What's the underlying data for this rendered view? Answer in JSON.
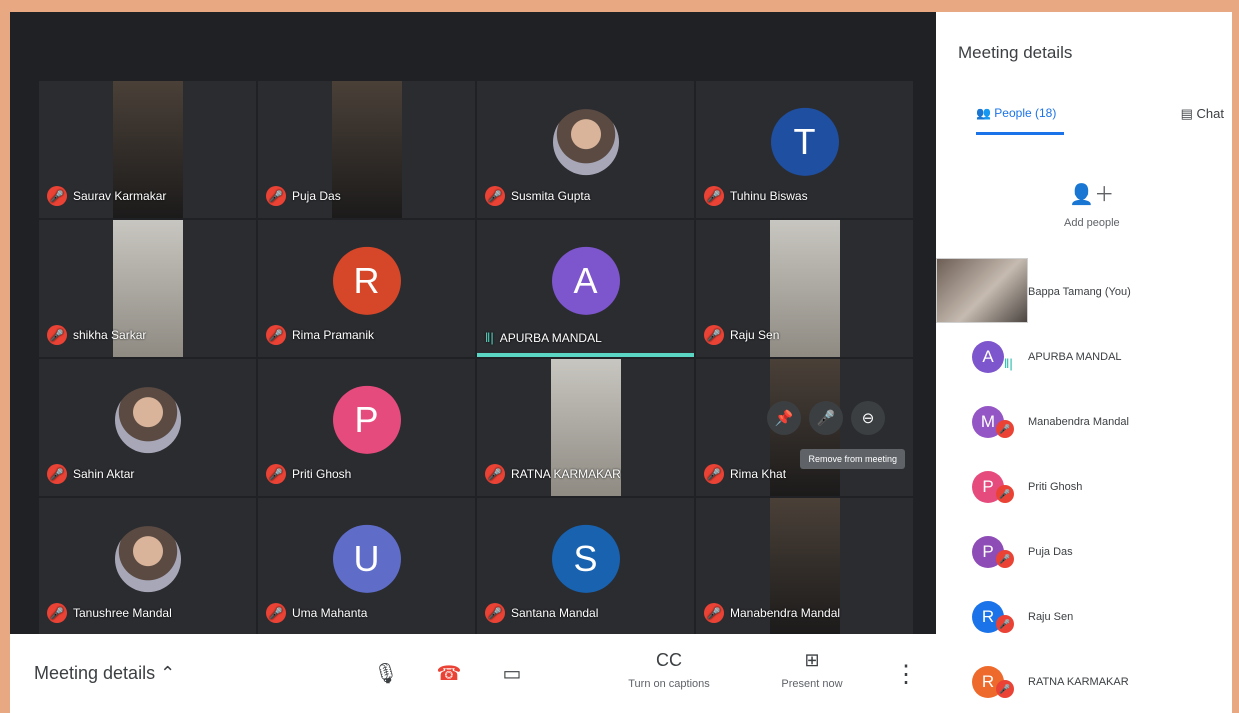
{
  "meeting": {
    "participants": [
      {
        "name": "Saurav Karmakar",
        "kind": "video"
      },
      {
        "name": "Puja Das",
        "kind": "video"
      },
      {
        "name": "Susmita Gupta",
        "kind": "photo"
      },
      {
        "name": "Tuhinu Biswas",
        "kind": "letter",
        "letter": "T",
        "color": "#1f4fa0"
      },
      {
        "name": "shikha Sarkar",
        "kind": "video",
        "light": true
      },
      {
        "name": "Rima Pramanik",
        "kind": "letter",
        "letter": "R",
        "color": "#d54728"
      },
      {
        "name": "APURBA MANDAL",
        "kind": "letter",
        "letter": "A",
        "color": "#7d55cc",
        "speaking": true
      },
      {
        "name": "Raju Sen",
        "kind": "video",
        "light": true
      },
      {
        "name": "Sahin Aktar",
        "kind": "photo"
      },
      {
        "name": "Priti Ghosh",
        "kind": "letter",
        "letter": "P",
        "color": "#e64b7d"
      },
      {
        "name": "RATNA KARMAKAR",
        "kind": "video",
        "light": true
      },
      {
        "name": "Rima Khat",
        "kind": "video",
        "controls": true
      },
      {
        "name": "Tanushree Mandal",
        "kind": "photo"
      },
      {
        "name": "Uma Mahanta",
        "kind": "letter",
        "letter": "U",
        "color": "#5f6dc9"
      },
      {
        "name": "Santana Mandal",
        "kind": "letter",
        "letter": "S",
        "color": "#1862b0"
      },
      {
        "name": "Manabendra Mandal",
        "kind": "video"
      }
    ]
  },
  "hover_tooltip": "Remove from meeting",
  "bottom": {
    "meeting_details": "Meeting details",
    "captions": "Turn on captions",
    "present": "Present now"
  },
  "panel": {
    "title": "Meeting details",
    "people_tab": "People (18)",
    "chat_tab": "Chat",
    "add_people": "Add people",
    "people": [
      {
        "name": "Bappa Tamang (You)",
        "self": true
      },
      {
        "name": "APURBA MANDAL",
        "letter": "A",
        "color": "#7d55cc",
        "speaking": true
      },
      {
        "name": "Manabendra Mandal",
        "letter": "M",
        "color": "#9455c5"
      },
      {
        "name": "Priti Ghosh",
        "letter": "P",
        "color": "#e64b7d"
      },
      {
        "name": "Puja Das",
        "letter": "P",
        "color": "#8e4cb7"
      },
      {
        "name": "Raju Sen",
        "letter": "R",
        "color": "#1a73e8"
      },
      {
        "name": "RATNA KARMAKAR",
        "letter": "R",
        "color": "#ee6a2c"
      }
    ]
  }
}
